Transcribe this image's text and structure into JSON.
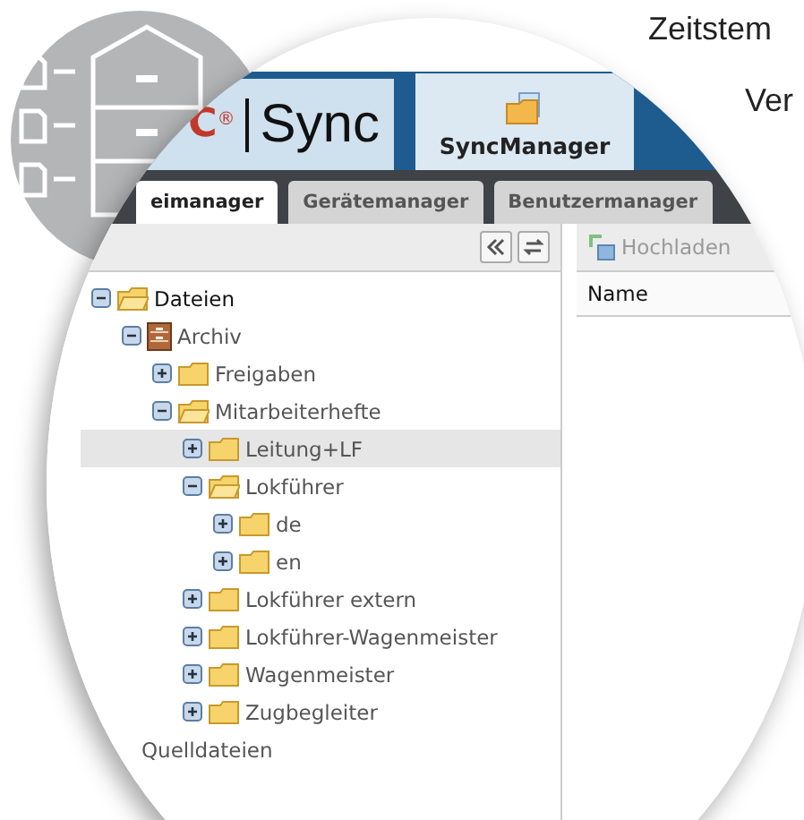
{
  "headline": [
    "Zeitstem",
    "Ver"
  ],
  "header": {
    "logo_mark": "C",
    "logo_registered": "®",
    "logo_text": "Sync",
    "app_tab": {
      "label": "SyncManager",
      "selected": true
    }
  },
  "tabs": [
    {
      "label": "eimanager",
      "selected": true
    },
    {
      "label": "Gerätemanager",
      "selected": false
    },
    {
      "label": "Benutzermanager",
      "selected": false
    }
  ],
  "toolbar": {
    "upload": {
      "label": "Hochladen",
      "disabled": true
    }
  },
  "table": {
    "columns": [
      "Name"
    ]
  },
  "tree": [
    {
      "label": "Dateien",
      "kind": "folder",
      "expanded": true,
      "selected": false,
      "children": [
        {
          "label": "Archiv",
          "kind": "archive",
          "expanded": true,
          "selected": false,
          "children": [
            {
              "label": "Freigaben",
              "kind": "folder",
              "expanded": false,
              "selected": false
            },
            {
              "label": "Mitarbeiterhefte",
              "kind": "folder",
              "expanded": true,
              "selected": false,
              "children": [
                {
                  "label": "Leitung+LF",
                  "kind": "folder",
                  "expanded": false,
                  "selected": true
                },
                {
                  "label": "Lokführer",
                  "kind": "folder",
                  "expanded": true,
                  "selected": false,
                  "children": [
                    {
                      "label": "de",
                      "kind": "folder",
                      "expanded": false,
                      "selected": false
                    },
                    {
                      "label": "en",
                      "kind": "folder",
                      "expanded": false,
                      "selected": false
                    }
                  ]
                },
                {
                  "label": "Lokführer extern",
                  "kind": "folder",
                  "expanded": false,
                  "selected": false
                },
                {
                  "label": "Lokführer-Wagenmeister",
                  "kind": "folder",
                  "expanded": false,
                  "selected": false
                },
                {
                  "label": "Wagenmeister",
                  "kind": "folder",
                  "expanded": false,
                  "selected": false
                },
                {
                  "label": "Zugbegleiter",
                  "kind": "folder",
                  "expanded": false,
                  "selected": false
                }
              ]
            }
          ]
        },
        {
          "label": "Quelldateien",
          "kind": "plain",
          "expanded": false,
          "selected": false
        }
      ]
    }
  ]
}
